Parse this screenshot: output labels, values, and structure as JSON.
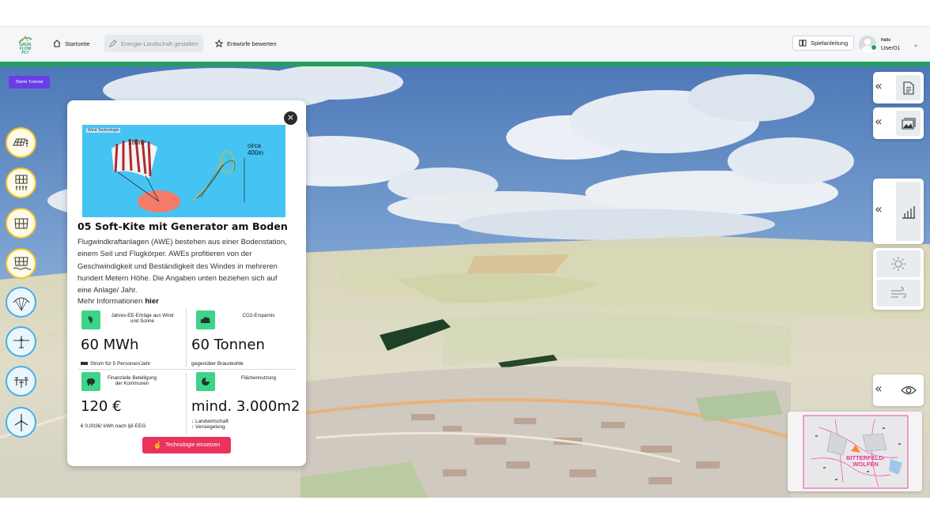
{
  "header": {
    "logo_lines": [
      "GRÜN",
      "FLOW",
      "PLY"
    ],
    "nav": [
      {
        "label": "Startseite",
        "icon": "home-icon",
        "active": false
      },
      {
        "label": "Energie-Landschaft gestalten",
        "icon": "pencil-icon",
        "active": true
      },
      {
        "label": "Entwürfe bewerten",
        "icon": "star-icon",
        "active": false
      }
    ],
    "guide_label": "Spielanleitung",
    "user": {
      "greeting": "Hallo",
      "name": "User01"
    }
  },
  "tutorial_button": "Starte Tutorial",
  "tech_buttons": [
    {
      "name": "solar-agri-icon",
      "style": "yellow"
    },
    {
      "name": "solar-vertical-icon",
      "style": "yellow"
    },
    {
      "name": "solar-panel-icon",
      "style": "yellow"
    },
    {
      "name": "solar-water-icon",
      "style": "yellow"
    },
    {
      "name": "kite-icon",
      "style": "blue"
    },
    {
      "name": "glider-icon",
      "style": "blue"
    },
    {
      "name": "drone-icon",
      "style": "blue"
    },
    {
      "name": "wind-turbine-icon",
      "style": "blue"
    }
  ],
  "panel": {
    "illustration": {
      "tag": "Wind Technologie",
      "area": "180m²",
      "height": "circa 400m"
    },
    "title": "05 Soft-Kite mit Generator am Boden",
    "description": "Flugwindkraftanlagen (AWE) bestehen aus einer Bodenstation, einem Seil und Flugkörper. AWEs profitieren von der Geschwindigkeit und Beständigkeit des Windes in mehreren hundert Metern Höhe. Die Angaben unten beziehen sich auf eine Anlage/ Jahr.",
    "more_prefix": "Mehr Informationen",
    "more_link": "hier",
    "stats": [
      {
        "label": "Jahres-EE-Erträge aus Wind und Sonne",
        "value": "60 MWh",
        "sub": "Strom für  5  Personen/Jahr",
        "icon": "energy-icon"
      },
      {
        "label": "CO2-Ersparnis",
        "value": "60 Tonnen",
        "sub": "gegenüber Braunkohle",
        "icon": "cloud-icon"
      },
      {
        "label": "Finanzielle Beteiligung der Kommunen",
        "value": "120 €",
        "sub": "€  0,002€/ kWh nach §6 EEG",
        "icon": "piggy-bank-icon"
      },
      {
        "label": "Flächennutzung",
        "value": "mind. 3.000m2",
        "sub_lines": [
          "↓ Landwirtschaft",
          "↑ Versiegelung"
        ],
        "icon": "pie-icon"
      }
    ],
    "deploy_label": "Technologie einsetzen"
  },
  "right_controls": [
    "document-icon",
    "image-icon",
    "chart-icon",
    "sun-icon",
    "wind-icon",
    "eye-icon"
  ],
  "minimap": {
    "label_lines": [
      "BITTERFELD-",
      "WOLFEN"
    ]
  },
  "colors": {
    "accent_green": "#22a060",
    "tutorial": "#6a3de8",
    "deploy": "#e9335e",
    "stat_icon": "#3fd38a"
  }
}
